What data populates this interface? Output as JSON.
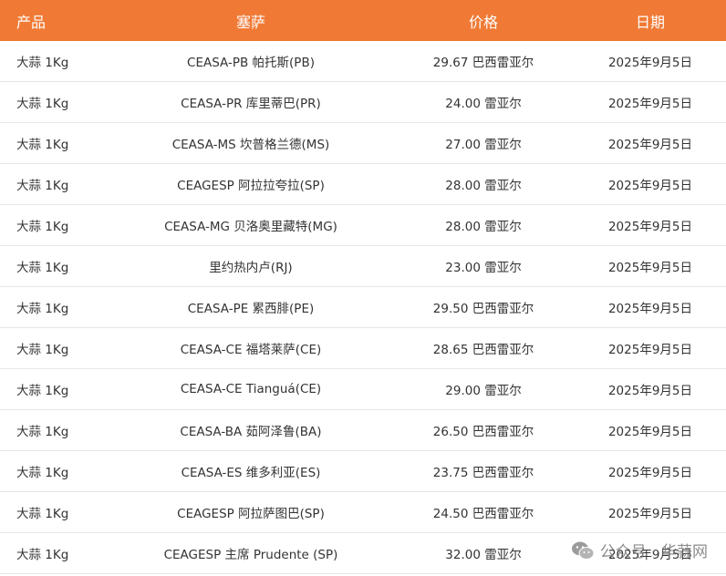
{
  "table": {
    "headers": [
      "产品",
      "塞萨",
      "价格",
      "日期"
    ],
    "rows": [
      {
        "product": "大蒜 1Kg",
        "market": "CEASA-PB 帕托斯(PB)",
        "price": "29.67 巴西雷亚尔",
        "date": "2025年9月5日"
      },
      {
        "product": "大蒜 1Kg",
        "market": "CEASA-PR 库里蒂巴(PR)",
        "price": "24.00 雷亚尔",
        "date": "2025年9月5日"
      },
      {
        "product": "大蒜 1Kg",
        "market": "CEASA-MS 坎普格兰德(MS)",
        "price": "27.00 雷亚尔",
        "date": "2025年9月5日"
      },
      {
        "product": "大蒜 1Kg",
        "market": "CEAGESP 阿拉拉夸拉(SP)",
        "price": "28.00 雷亚尔",
        "date": "2025年9月5日"
      },
      {
        "product": "大蒜 1Kg",
        "market": "CEASA-MG 贝洛奥里藏特(MG)",
        "price": "28.00 雷亚尔",
        "date": "2025年9月5日"
      },
      {
        "product": "大蒜 1Kg",
        "market": "里约热内卢(RJ)",
        "price": "23.00 雷亚尔",
        "date": "2025年9月5日"
      },
      {
        "product": "大蒜 1Kg",
        "market": "CEASA-PE 累西腓(PE)",
        "price": "29.50 巴西雷亚尔",
        "date": "2025年9月5日"
      },
      {
        "product": "大蒜 1Kg",
        "market": "CEASA-CE 福塔莱萨(CE)",
        "price": "28.65 巴西雷亚尔",
        "date": "2025年9月5日"
      },
      {
        "product": "大蒜 1Kg",
        "market": "CEASA-CE Tianguá(CE)",
        "price": "29.00 雷亚尔",
        "date": "2025年9月5日"
      },
      {
        "product": "大蒜 1Kg",
        "market": "CEASA-BA 茹阿泽鲁(BA)",
        "price": "26.50 巴西雷亚尔",
        "date": "2025年9月5日"
      },
      {
        "product": "大蒜 1Kg",
        "market": "CEASA-ES 维多利亚(ES)",
        "price": "23.75 巴西雷亚尔",
        "date": "2025年9月5日"
      },
      {
        "product": "大蒜 1Kg",
        "market": "CEAGESP 阿拉萨图巴(SP)",
        "price": "24.50 巴西雷亚尔",
        "date": "2025年9月5日"
      },
      {
        "product": "大蒜 1Kg",
        "market": "CEAGESP 主席 Prudente (SP)",
        "price": "32.00 雷亚尔",
        "date": "2025年9月5日"
      }
    ]
  },
  "watermark": {
    "text": "公众号 · 华蒜网",
    "icon": "wechat-icon"
  },
  "colors": {
    "header_bg": "#f07a35",
    "header_text": "#ffffff",
    "row_text": "#333333",
    "row_border": "#e6e6e6"
  }
}
